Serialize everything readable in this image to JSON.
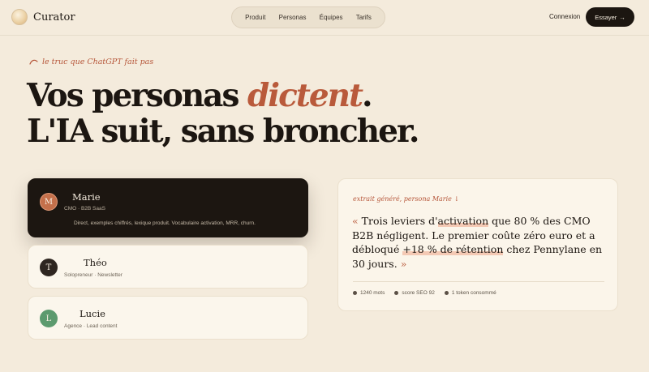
{
  "brand": {
    "name": "Curator"
  },
  "nav": {
    "items": [
      "Produit",
      "Personas",
      "Équipes",
      "Tarifs"
    ]
  },
  "header": {
    "login_label": "Connexion",
    "cta_label": "Essayer",
    "cta_arrow": "→"
  },
  "hero": {
    "kicker": "le truc que ChatGPT fait pas",
    "kicker_icon": "swoosh-icon",
    "headline_part1": "Vos personas",
    "headline_accent": "dictent",
    "headline_period": ".",
    "headline_line2": "L'IA suit, sans broncher."
  },
  "personas": [
    {
      "initial": "M",
      "name": "Marie",
      "subtitle": "CMO · B2B SaaS",
      "description": "Direct, exemples chiffrés, lexique produit. Vocabulaire activation, MRR, churn.",
      "active": true,
      "color": "#c4704b"
    },
    {
      "initial": "T",
      "name": "Théo",
      "subtitle": "Solopreneur · Newsletter",
      "active": false,
      "color": "#2e2620"
    },
    {
      "initial": "L",
      "name": "Lucie",
      "subtitle": "Agence · Lead content",
      "active": false,
      "color": "#5c9a6e"
    }
  ],
  "excerpt": {
    "label": "extrait généré, persona Marie ↓",
    "quote_open": "«",
    "quote_a": "Trois leviers d'",
    "quote_hl1": "activation",
    "quote_b": " que 80 % des CMO B2B négligent. Le premier coûte zéro euro et a débloqué ",
    "quote_hl2": "+18 % de rétention",
    "quote_c": " chez Pennylane en 30 jours.",
    "quote_close": "»",
    "stats": [
      "1240 mots",
      "score SEO 92",
      "1 token consommé"
    ]
  },
  "colors": {
    "accent": "#b95a3b",
    "background": "#f4ebdc",
    "dark": "#1c1611"
  }
}
